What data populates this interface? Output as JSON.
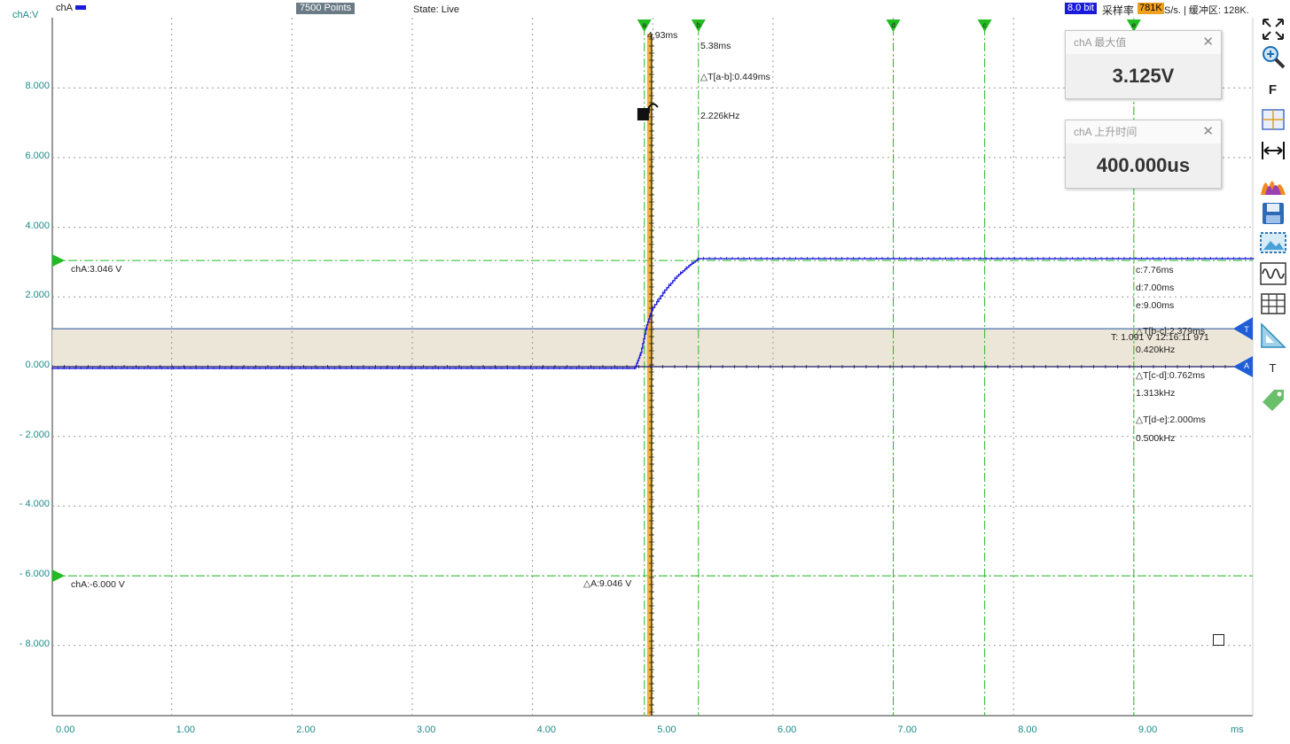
{
  "topbar": {
    "channel_label": "chA",
    "points": "7500 Points",
    "state": "State: Live",
    "bits": "8.0 bit",
    "sample_rate_label": "采样率",
    "sample_rate_value": "781K",
    "sample_rate_tail": "S/s. | 缓冲区: 128K."
  },
  "colors": {
    "waveform": "#1a1adb",
    "cursor_green": "#22bb22",
    "grid": "#9a9a9a",
    "trigger_band": "#ece6d8",
    "axis_label": "#1f8a8a",
    "accent_orange": "#f0a020"
  },
  "chart_data": {
    "type": "line",
    "y_unit": "chA:V",
    "x_unit": "ms",
    "xlim": [
      0,
      10
    ],
    "ylim": [
      -10,
      10
    ],
    "x_ticks": [
      "0.00",
      "1.00",
      "2.00",
      "3.00",
      "4.00",
      "5.00",
      "6.00",
      "7.00",
      "8.00",
      "9.00"
    ],
    "y_ticks": [
      {
        "v": 8,
        "label": "8.000"
      },
      {
        "v": 6,
        "label": "6.000"
      },
      {
        "v": 4,
        "label": "4.000"
      },
      {
        "v": 2,
        "label": "2.000"
      },
      {
        "v": 0,
        "label": "0.000"
      },
      {
        "v": -2,
        "label": "- 2.000"
      },
      {
        "v": -4,
        "label": "- 4.000"
      },
      {
        "v": -6,
        "label": "- 6.000"
      },
      {
        "v": -8,
        "label": "- 8.000"
      }
    ],
    "grid": true,
    "series": [
      {
        "name": "chA",
        "x": [
          0,
          4.85,
          4.9,
          4.95,
          5.0,
          5.1,
          5.2,
          5.3,
          5.38,
          6.0,
          7.0,
          8.0,
          9.0,
          10.0
        ],
        "y": [
          -0.05,
          -0.05,
          0.4,
          1.2,
          1.7,
          2.2,
          2.6,
          2.9,
          3.1,
          3.1,
          3.1,
          3.1,
          3.1,
          3.1
        ]
      }
    ],
    "vertical_cursors": [
      {
        "label": "a",
        "x": 4.93
      },
      {
        "label": "b",
        "x": 5.38
      },
      {
        "label": "d",
        "x": 7.0
      },
      {
        "label": "c",
        "x": 7.76
      },
      {
        "label": "e",
        "x": 9.0
      }
    ],
    "horizontal_cursors": [
      {
        "value": 3.046,
        "label": "chA:3.046 V"
      },
      {
        "value": -6.0,
        "label": "chA:-6.000 V"
      }
    ],
    "trigger": {
      "level": 1.091,
      "label": "T: 1.091 V   12:16:11 971",
      "marker": "T",
      "x_ms": 4.99
    },
    "zero_marker": "A"
  },
  "measurements": {
    "a_time": "4.93ms",
    "b_time": "5.38ms",
    "dt_ab": "△T[a-b]:0.449ms",
    "freq_ab": "2.226kHz",
    "c_time": "c:7.76ms",
    "d_time": "d:7.00ms",
    "e_time": "e:9.00ms",
    "dt_bc": "△T[b-c]:2.379ms",
    "freq_bc": "0.420kHz",
    "dt_cd": "△T[c-d]:0.762ms",
    "freq_cd": "1.313kHz",
    "dt_de": "△T[d-e]:2.000ms",
    "freq_de": "0.500kHz",
    "delta_a": "△A:9.046 V"
  },
  "panels": [
    {
      "title": "chA 最大值",
      "value": "3.125V"
    },
    {
      "title": "chA 上升时间",
      "value": "400.000us"
    }
  ],
  "toolbar": {
    "tools": [
      "fit-screen",
      "zoom",
      "font",
      "cursor-cross",
      "measure-width",
      "spectrum",
      "save",
      "screenshot",
      "waveform",
      "grid-table",
      "ruler",
      "text",
      "tag"
    ],
    "font_label": "F",
    "text_label": "T"
  }
}
